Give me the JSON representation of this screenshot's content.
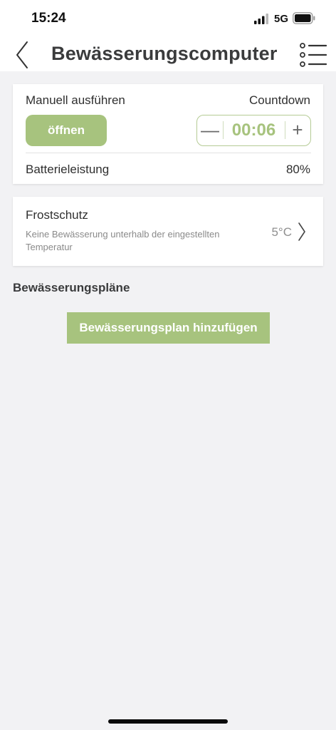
{
  "status_bar": {
    "time": "15:24",
    "network": "5G",
    "signal_icon": "signal-bars-icon",
    "battery_icon": "battery-icon"
  },
  "nav": {
    "title": "Bewässerungscomputer",
    "back_icon": "chevron-left-icon",
    "menu_icon": "list-menu-icon"
  },
  "manual": {
    "label": "Manuell ausführen",
    "countdown_label": "Countdown",
    "open_button": "öffnen",
    "countdown_value": "00:06",
    "minus": "—",
    "plus": "+",
    "battery_label": "Batterieleistung",
    "battery_value": "80%"
  },
  "frost": {
    "title": "Frostschutz",
    "description": "Keine Bewässerung unterhalb der eingestellten Temperatur",
    "value": "5°C"
  },
  "schedules": {
    "title": "Bewässerungspläne",
    "add_button": "Bewässerungsplan hinzufügen"
  },
  "colors": {
    "accent": "#a7c37e",
    "background": "#f2f2f4",
    "title_text": "#3a3b3c"
  }
}
